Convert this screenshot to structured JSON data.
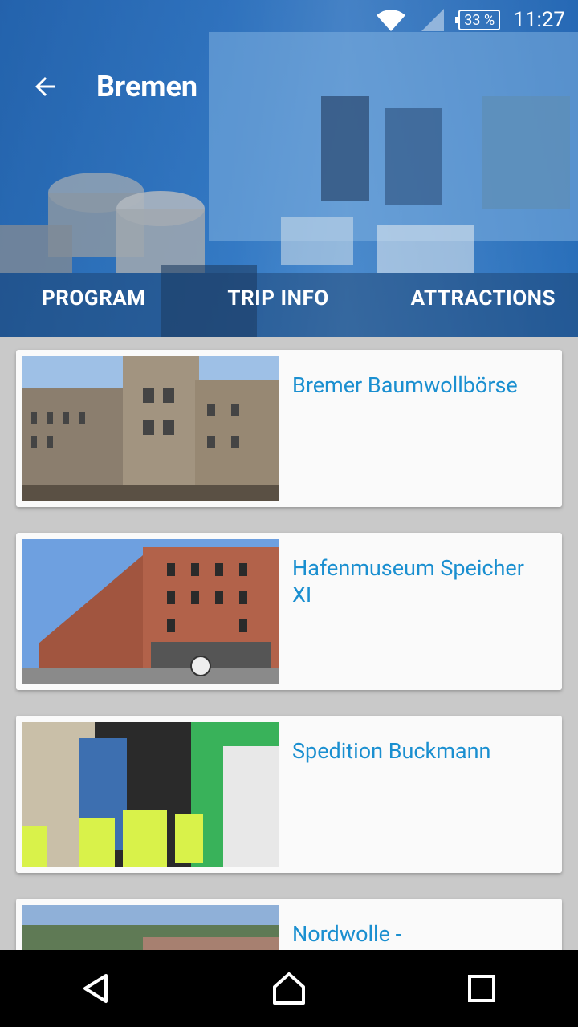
{
  "status": {
    "battery": "33 %",
    "time": "11:27"
  },
  "toolbar": {
    "title": "Bremen"
  },
  "tabs": [
    {
      "label": "PROGRAM"
    },
    {
      "label": "TRIP INFO"
    },
    {
      "label": "ATTRACTIONS"
    }
  ],
  "attractions": [
    {
      "title": "Bremer Baumwollbörse"
    },
    {
      "title": "Hafenmuseum Speicher XI"
    },
    {
      "title": "Spedition Buckmann"
    },
    {
      "title": "Nordwolle -"
    }
  ],
  "colors": {
    "accent": "#1a8fd0",
    "header_tint": "#2f6fb0"
  }
}
